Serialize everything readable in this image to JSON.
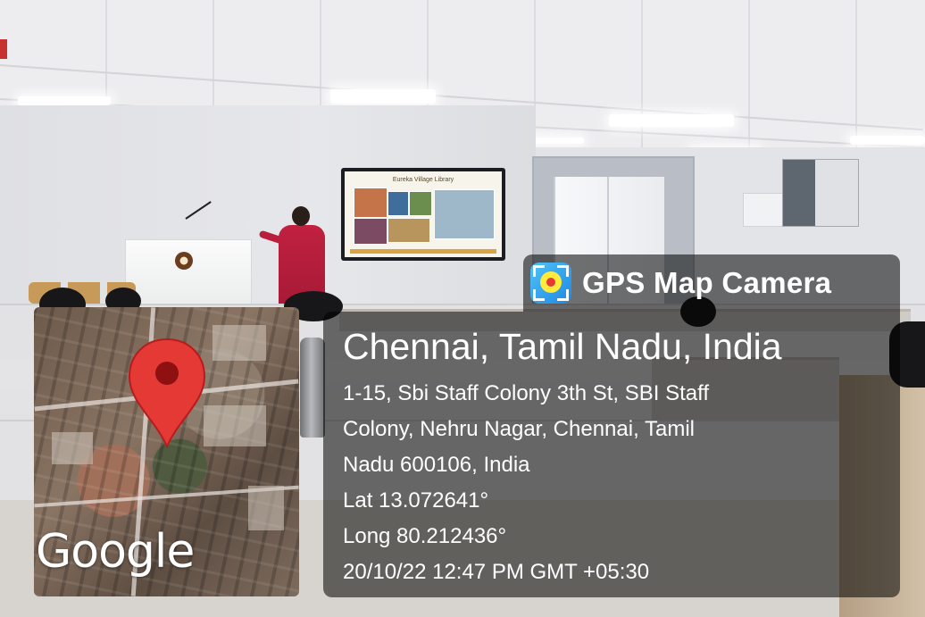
{
  "overlay": {
    "app_name": "GPS Map Camera",
    "app_icon": "gps-map-camera-icon",
    "location_title": "Chennai, Tamil Nadu, India",
    "address_lines": [
      "1-15, Sbi Staff Colony 3th St, SBI Staff",
      "Colony, Nehru Nagar, Chennai, Tamil",
      "Nadu 600106, India"
    ],
    "latitude": "Lat 13.072641°",
    "longitude": "Long 80.212436°",
    "timestamp": "20/10/22 12:47 PM GMT +05:30"
  },
  "map": {
    "provider_wordmark": "Google",
    "pin_color": "#e53935"
  },
  "scene": {
    "tv_slide_title": "Eureka Village Library"
  },
  "colors": {
    "overlay_bg": "rgba(0,0,0,0.55)",
    "overlay_text": "#ffffff",
    "speaker_dress": "#b91e3c"
  }
}
